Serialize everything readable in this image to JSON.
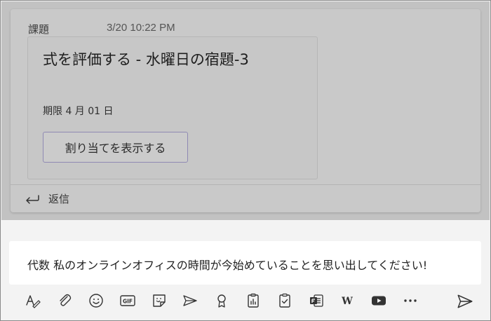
{
  "message": {
    "label": "課題",
    "timestamp": "3/20 10:22 PM",
    "assignment": {
      "title": "式を評価する - 水曜日の宿題-3",
      "due": "期限 4 月 01 日",
      "view_button": "割り当てを表示する"
    },
    "reply_label": "返信"
  },
  "compose": {
    "text": "代数 私のオンラインオフィスの時間が今始めていることを思い出してください!"
  },
  "toolbar": {
    "gif_label": "GIF",
    "wiki_label": "W",
    "more_label": "•••"
  },
  "colors": {
    "dim_overlay": "#c2c2c2",
    "button_border": "#8f89b3",
    "compose_bg": "#ffffff",
    "page_bg": "#f3f3f3"
  },
  "icons": [
    "format-icon",
    "attach-icon",
    "emoji-icon",
    "gif-icon",
    "sticker-icon",
    "meet-icon",
    "praise-icon",
    "insights-icon",
    "assignments-icon",
    "forms-icon",
    "wiki-icon",
    "youtube-icon",
    "more-icon",
    "send-icon"
  ]
}
